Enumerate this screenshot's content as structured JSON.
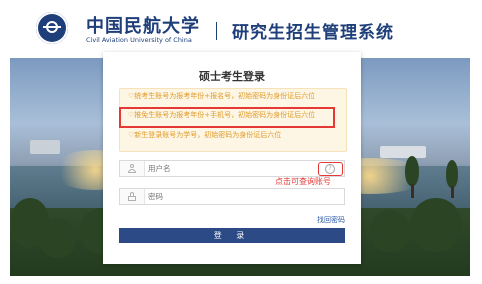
{
  "header": {
    "university_name_cn": "中国民航大学",
    "university_name_en": "Civil Aviation University of China",
    "system_title": "研究生招生管理系统"
  },
  "login": {
    "title": "硕士考生登录",
    "notices": [
      "♡统考生账号为报考年份+报名号，初始密码为身份证后六位",
      "♡推免生账号为报考年份+手机号，初始密码为身份证后六位",
      "♡新生登录账号为学号，初始密码为身份证后六位"
    ],
    "username_placeholder": "用户名",
    "help_icon": "?",
    "password_placeholder": "密码",
    "forgot_password": "找回密码",
    "submit": "登 录"
  },
  "annotation": {
    "text": "点击可查询账号",
    "color": "#e53935"
  },
  "colors": {
    "brand": "#1f3f7a",
    "button": "#2b4a86",
    "notice_text": "#e09a2a",
    "notice_bg": "#fdf6e4"
  },
  "icons": [
    "user-icon",
    "lock-icon",
    "help-icon",
    "university-logo"
  ]
}
